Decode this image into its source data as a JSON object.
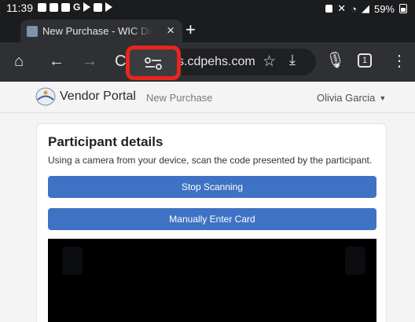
{
  "status_bar": {
    "time": "11:39",
    "left_icons": [
      "cloud-icon",
      "sim-icon",
      "camera-icon",
      "g-icon",
      "play-icon",
      "image-icon",
      "play-icon"
    ],
    "battery_percent": "59%",
    "right_icons": [
      "lock-icon",
      "mute-icon",
      "wifi-icon",
      "signal-icon",
      "battery-icon"
    ]
  },
  "browser": {
    "tab_title": "New Purchase - WIC Direct V",
    "url": "s.cdpehs.com",
    "tab_count": "1",
    "highlight_color": "#e8251e"
  },
  "page_nav": {
    "brand": "Vendor Portal",
    "nav_link": "New Purchase",
    "user_name": "Olivia Garcia"
  },
  "card": {
    "title": "Participant details",
    "description": "Using a camera from your device, scan the code presented by the participant.",
    "stop_button": "Stop Scanning",
    "manual_button": "Manually Enter Card",
    "button_color": "#3f72c4"
  }
}
